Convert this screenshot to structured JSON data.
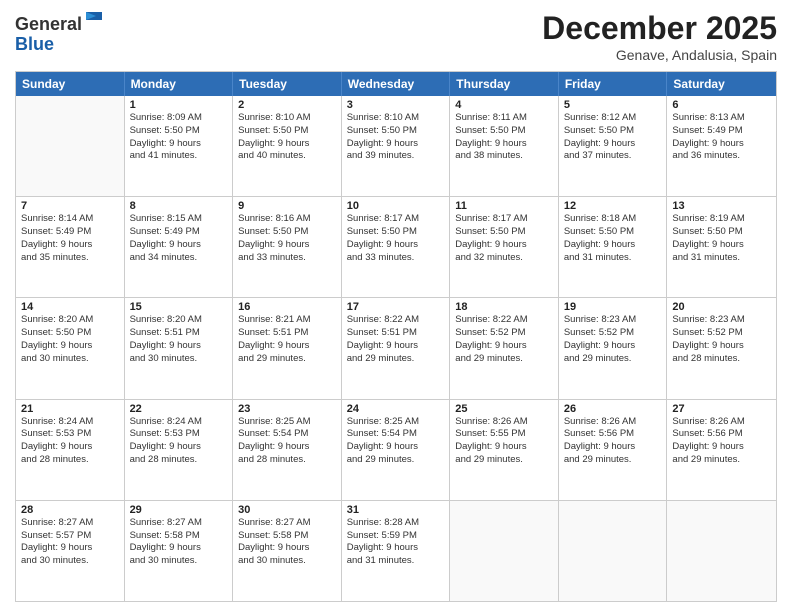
{
  "header": {
    "logo_general": "General",
    "logo_blue": "Blue",
    "month_title": "December 2025",
    "subtitle": "Genave, Andalusia, Spain"
  },
  "weekdays": [
    "Sunday",
    "Monday",
    "Tuesday",
    "Wednesday",
    "Thursday",
    "Friday",
    "Saturday"
  ],
  "rows": [
    [
      {
        "day": "",
        "empty": true
      },
      {
        "day": "1",
        "lines": [
          "Sunrise: 8:09 AM",
          "Sunset: 5:50 PM",
          "Daylight: 9 hours",
          "and 41 minutes."
        ]
      },
      {
        "day": "2",
        "lines": [
          "Sunrise: 8:10 AM",
          "Sunset: 5:50 PM",
          "Daylight: 9 hours",
          "and 40 minutes."
        ]
      },
      {
        "day": "3",
        "lines": [
          "Sunrise: 8:10 AM",
          "Sunset: 5:50 PM",
          "Daylight: 9 hours",
          "and 39 minutes."
        ]
      },
      {
        "day": "4",
        "lines": [
          "Sunrise: 8:11 AM",
          "Sunset: 5:50 PM",
          "Daylight: 9 hours",
          "and 38 minutes."
        ]
      },
      {
        "day": "5",
        "lines": [
          "Sunrise: 8:12 AM",
          "Sunset: 5:50 PM",
          "Daylight: 9 hours",
          "and 37 minutes."
        ]
      },
      {
        "day": "6",
        "lines": [
          "Sunrise: 8:13 AM",
          "Sunset: 5:49 PM",
          "Daylight: 9 hours",
          "and 36 minutes."
        ]
      }
    ],
    [
      {
        "day": "7",
        "lines": [
          "Sunrise: 8:14 AM",
          "Sunset: 5:49 PM",
          "Daylight: 9 hours",
          "and 35 minutes."
        ]
      },
      {
        "day": "8",
        "lines": [
          "Sunrise: 8:15 AM",
          "Sunset: 5:49 PM",
          "Daylight: 9 hours",
          "and 34 minutes."
        ]
      },
      {
        "day": "9",
        "lines": [
          "Sunrise: 8:16 AM",
          "Sunset: 5:50 PM",
          "Daylight: 9 hours",
          "and 33 minutes."
        ]
      },
      {
        "day": "10",
        "lines": [
          "Sunrise: 8:17 AM",
          "Sunset: 5:50 PM",
          "Daylight: 9 hours",
          "and 33 minutes."
        ]
      },
      {
        "day": "11",
        "lines": [
          "Sunrise: 8:17 AM",
          "Sunset: 5:50 PM",
          "Daylight: 9 hours",
          "and 32 minutes."
        ]
      },
      {
        "day": "12",
        "lines": [
          "Sunrise: 8:18 AM",
          "Sunset: 5:50 PM",
          "Daylight: 9 hours",
          "and 31 minutes."
        ]
      },
      {
        "day": "13",
        "lines": [
          "Sunrise: 8:19 AM",
          "Sunset: 5:50 PM",
          "Daylight: 9 hours",
          "and 31 minutes."
        ]
      }
    ],
    [
      {
        "day": "14",
        "lines": [
          "Sunrise: 8:20 AM",
          "Sunset: 5:50 PM",
          "Daylight: 9 hours",
          "and 30 minutes."
        ]
      },
      {
        "day": "15",
        "lines": [
          "Sunrise: 8:20 AM",
          "Sunset: 5:51 PM",
          "Daylight: 9 hours",
          "and 30 minutes."
        ]
      },
      {
        "day": "16",
        "lines": [
          "Sunrise: 8:21 AM",
          "Sunset: 5:51 PM",
          "Daylight: 9 hours",
          "and 29 minutes."
        ]
      },
      {
        "day": "17",
        "lines": [
          "Sunrise: 8:22 AM",
          "Sunset: 5:51 PM",
          "Daylight: 9 hours",
          "and 29 minutes."
        ]
      },
      {
        "day": "18",
        "lines": [
          "Sunrise: 8:22 AM",
          "Sunset: 5:52 PM",
          "Daylight: 9 hours",
          "and 29 minutes."
        ]
      },
      {
        "day": "19",
        "lines": [
          "Sunrise: 8:23 AM",
          "Sunset: 5:52 PM",
          "Daylight: 9 hours",
          "and 29 minutes."
        ]
      },
      {
        "day": "20",
        "lines": [
          "Sunrise: 8:23 AM",
          "Sunset: 5:52 PM",
          "Daylight: 9 hours",
          "and 28 minutes."
        ]
      }
    ],
    [
      {
        "day": "21",
        "lines": [
          "Sunrise: 8:24 AM",
          "Sunset: 5:53 PM",
          "Daylight: 9 hours",
          "and 28 minutes."
        ]
      },
      {
        "day": "22",
        "lines": [
          "Sunrise: 8:24 AM",
          "Sunset: 5:53 PM",
          "Daylight: 9 hours",
          "and 28 minutes."
        ]
      },
      {
        "day": "23",
        "lines": [
          "Sunrise: 8:25 AM",
          "Sunset: 5:54 PM",
          "Daylight: 9 hours",
          "and 28 minutes."
        ]
      },
      {
        "day": "24",
        "lines": [
          "Sunrise: 8:25 AM",
          "Sunset: 5:54 PM",
          "Daylight: 9 hours",
          "and 29 minutes."
        ]
      },
      {
        "day": "25",
        "lines": [
          "Sunrise: 8:26 AM",
          "Sunset: 5:55 PM",
          "Daylight: 9 hours",
          "and 29 minutes."
        ]
      },
      {
        "day": "26",
        "lines": [
          "Sunrise: 8:26 AM",
          "Sunset: 5:56 PM",
          "Daylight: 9 hours",
          "and 29 minutes."
        ]
      },
      {
        "day": "27",
        "lines": [
          "Sunrise: 8:26 AM",
          "Sunset: 5:56 PM",
          "Daylight: 9 hours",
          "and 29 minutes."
        ]
      }
    ],
    [
      {
        "day": "28",
        "lines": [
          "Sunrise: 8:27 AM",
          "Sunset: 5:57 PM",
          "Daylight: 9 hours",
          "and 30 minutes."
        ]
      },
      {
        "day": "29",
        "lines": [
          "Sunrise: 8:27 AM",
          "Sunset: 5:58 PM",
          "Daylight: 9 hours",
          "and 30 minutes."
        ]
      },
      {
        "day": "30",
        "lines": [
          "Sunrise: 8:27 AM",
          "Sunset: 5:58 PM",
          "Daylight: 9 hours",
          "and 30 minutes."
        ]
      },
      {
        "day": "31",
        "lines": [
          "Sunrise: 8:28 AM",
          "Sunset: 5:59 PM",
          "Daylight: 9 hours",
          "and 31 minutes."
        ]
      },
      {
        "day": "",
        "empty": true
      },
      {
        "day": "",
        "empty": true
      },
      {
        "day": "",
        "empty": true
      }
    ]
  ]
}
